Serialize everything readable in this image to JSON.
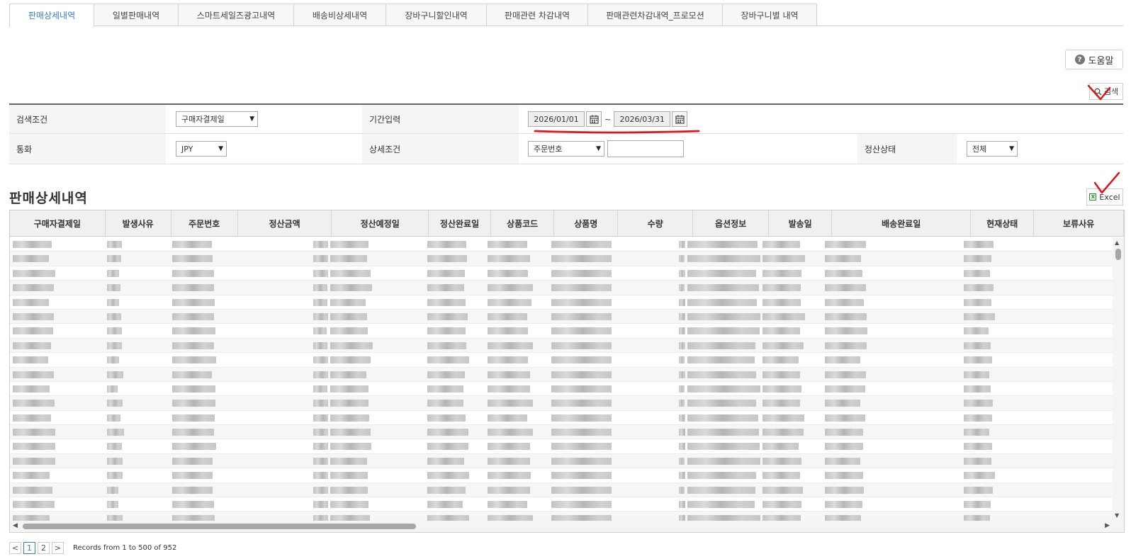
{
  "tabs": [
    {
      "label": "판매상세내역",
      "active": true
    },
    {
      "label": "일별판매내역",
      "active": false
    },
    {
      "label": "스마트세일즈광고내역",
      "active": false
    },
    {
      "label": "배송비상세내역",
      "active": false
    },
    {
      "label": "장바구니할인내역",
      "active": false
    },
    {
      "label": "판매관련 차감내역",
      "active": false
    },
    {
      "label": "판매관련차감내역_프로모션",
      "active": false
    },
    {
      "label": "장바구니별 내역",
      "active": false
    }
  ],
  "toolbar": {
    "help_label": "도움말",
    "search_label": "검색"
  },
  "filter": {
    "search_condition_label": "검색조건",
    "search_condition_value": "구매자결제일",
    "period_label": "기간입력",
    "date_from": "2026/01/01",
    "date_to": "2026/03/31",
    "date_separator": "~",
    "currency_label": "통화",
    "currency_value": "JPY",
    "detail_condition_label": "상세조건",
    "detail_condition_value": "주문번호",
    "detail_condition_text": "",
    "settlement_status_label": "정산상태",
    "settlement_status_value": "전체"
  },
  "section": {
    "title": "판매상세내역",
    "excel_label": "Excel"
  },
  "grid": {
    "columns": [
      "구매자결제일",
      "발생사유",
      "주문번호",
      "정산금액",
      "정산예정일",
      "정산완료일",
      "상품코드",
      "상품명",
      "수량",
      "옵션정보",
      "발송일",
      "배송완료일",
      "현재상태",
      "보류사유"
    ],
    "visible_row_count": 20
  },
  "pager": {
    "prev": "<",
    "pages": [
      "1",
      "2"
    ],
    "current_page": "1",
    "next": ">",
    "records_text": "Records from 1 to 500 of 952"
  },
  "colors": {
    "accent": "#3a7bd5",
    "annotation": "#e0141e"
  }
}
